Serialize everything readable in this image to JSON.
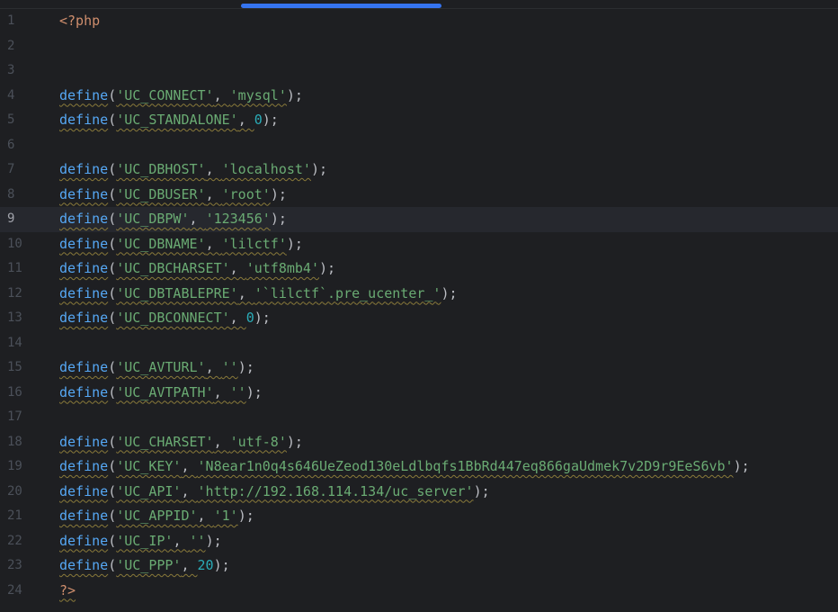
{
  "editor": {
    "current_line": 9,
    "colors": {
      "background": "#1e1f22",
      "keyword": "#cf8e6d",
      "function": "#56a8f5",
      "string": "#6aab73",
      "number": "#2aacb8",
      "text": "#bcbec4",
      "line_number": "#4b5059",
      "scrollbar_thumb": "#3574f0"
    },
    "lines": [
      {
        "num": "1",
        "tokens": [
          [
            "kw",
            "<?php"
          ]
        ]
      },
      {
        "num": "2",
        "tokens": []
      },
      {
        "num": "3",
        "tokens": []
      },
      {
        "num": "4",
        "tokens": [
          [
            "fn",
            "define"
          ],
          [
            "punc",
            "("
          ],
          [
            "str",
            "'UC_CONNECT'"
          ],
          [
            "sep",
            ", "
          ],
          [
            "str",
            "'mysql'"
          ],
          [
            "punc",
            ");"
          ]
        ]
      },
      {
        "num": "5",
        "tokens": [
          [
            "fn",
            "define"
          ],
          [
            "punc",
            "("
          ],
          [
            "str",
            "'UC_STANDALONE'"
          ],
          [
            "sep",
            ", "
          ],
          [
            "num",
            "0"
          ],
          [
            "punc",
            ");"
          ]
        ]
      },
      {
        "num": "6",
        "tokens": []
      },
      {
        "num": "7",
        "tokens": [
          [
            "fn",
            "define"
          ],
          [
            "punc",
            "("
          ],
          [
            "str",
            "'UC_DBHOST'"
          ],
          [
            "sep",
            ", "
          ],
          [
            "str",
            "'localhost'"
          ],
          [
            "punc",
            ");"
          ]
        ]
      },
      {
        "num": "8",
        "tokens": [
          [
            "fn",
            "define"
          ],
          [
            "punc",
            "("
          ],
          [
            "str",
            "'UC_DBUSER'"
          ],
          [
            "sep",
            ", "
          ],
          [
            "str",
            "'root'"
          ],
          [
            "punc",
            ");"
          ]
        ]
      },
      {
        "num": "9",
        "tokens": [
          [
            "fn",
            "define"
          ],
          [
            "punc",
            "("
          ],
          [
            "str",
            "'UC_DBPW'"
          ],
          [
            "sep",
            ", "
          ],
          [
            "str",
            "'123456'"
          ],
          [
            "punc",
            ");"
          ]
        ]
      },
      {
        "num": "10",
        "tokens": [
          [
            "fn",
            "define"
          ],
          [
            "punc",
            "("
          ],
          [
            "str",
            "'UC_DBNAME'"
          ],
          [
            "sep",
            ", "
          ],
          [
            "str",
            "'lilctf'"
          ],
          [
            "punc",
            ");"
          ]
        ]
      },
      {
        "num": "11",
        "tokens": [
          [
            "fn",
            "define"
          ],
          [
            "punc",
            "("
          ],
          [
            "str",
            "'UC_DBCHARSET'"
          ],
          [
            "sep",
            ", "
          ],
          [
            "str",
            "'utf8mb4'"
          ],
          [
            "punc",
            ");"
          ]
        ]
      },
      {
        "num": "12",
        "tokens": [
          [
            "fn",
            "define"
          ],
          [
            "punc",
            "("
          ],
          [
            "str",
            "'UC_DBTABLEPRE'"
          ],
          [
            "sep",
            ", "
          ],
          [
            "str",
            "'`lilctf`.pre_ucenter_'"
          ],
          [
            "punc",
            ");"
          ]
        ]
      },
      {
        "num": "13",
        "tokens": [
          [
            "fn",
            "define"
          ],
          [
            "punc",
            "("
          ],
          [
            "str",
            "'UC_DBCONNECT'"
          ],
          [
            "sep",
            ", "
          ],
          [
            "num",
            "0"
          ],
          [
            "punc",
            ");"
          ]
        ]
      },
      {
        "num": "14",
        "tokens": []
      },
      {
        "num": "15",
        "tokens": [
          [
            "fn",
            "define"
          ],
          [
            "punc",
            "("
          ],
          [
            "str",
            "'UC_AVTURL'"
          ],
          [
            "sep",
            ", "
          ],
          [
            "str",
            "''"
          ],
          [
            "punc",
            ");"
          ]
        ]
      },
      {
        "num": "16",
        "tokens": [
          [
            "fn",
            "define"
          ],
          [
            "punc",
            "("
          ],
          [
            "str",
            "'UC_AVTPATH'"
          ],
          [
            "sep",
            ", "
          ],
          [
            "str",
            "''"
          ],
          [
            "punc",
            ");"
          ]
        ]
      },
      {
        "num": "17",
        "tokens": []
      },
      {
        "num": "18",
        "tokens": [
          [
            "fn",
            "define"
          ],
          [
            "punc",
            "("
          ],
          [
            "str",
            "'UC_CHARSET'"
          ],
          [
            "sep",
            ", "
          ],
          [
            "str",
            "'utf-8'"
          ],
          [
            "punc",
            ");"
          ]
        ]
      },
      {
        "num": "19",
        "tokens": [
          [
            "fn",
            "define"
          ],
          [
            "punc",
            "("
          ],
          [
            "str",
            "'UC_KEY'"
          ],
          [
            "sep",
            ", "
          ],
          [
            "str",
            "'N8ear1n0q4s646UeZeod130eLdlbqfs1BbRd447eq866gaUdmek7v2D9r9EeS6vb'"
          ],
          [
            "punc",
            ");"
          ]
        ]
      },
      {
        "num": "20",
        "tokens": [
          [
            "fn",
            "define"
          ],
          [
            "punc",
            "("
          ],
          [
            "str",
            "'UC_API'"
          ],
          [
            "sep",
            ", "
          ],
          [
            "str",
            "'http://192.168.114.134/uc_server'"
          ],
          [
            "punc",
            ");"
          ]
        ]
      },
      {
        "num": "21",
        "tokens": [
          [
            "fn",
            "define"
          ],
          [
            "punc",
            "("
          ],
          [
            "str",
            "'UC_APPID'"
          ],
          [
            "sep",
            ", "
          ],
          [
            "str",
            "'1'"
          ],
          [
            "punc",
            ");"
          ]
        ]
      },
      {
        "num": "22",
        "tokens": [
          [
            "fn",
            "define"
          ],
          [
            "punc",
            "("
          ],
          [
            "str",
            "'UC_IP'"
          ],
          [
            "sep",
            ", "
          ],
          [
            "str",
            "''"
          ],
          [
            "punc",
            ");"
          ]
        ]
      },
      {
        "num": "23",
        "tokens": [
          [
            "fn",
            "define"
          ],
          [
            "punc",
            "("
          ],
          [
            "str",
            "'UC_PPP'"
          ],
          [
            "sep",
            ", "
          ],
          [
            "num",
            "20"
          ],
          [
            "punc",
            ");"
          ]
        ]
      },
      {
        "num": "24",
        "tokens": [
          [
            "end",
            "?>"
          ]
        ]
      }
    ]
  }
}
